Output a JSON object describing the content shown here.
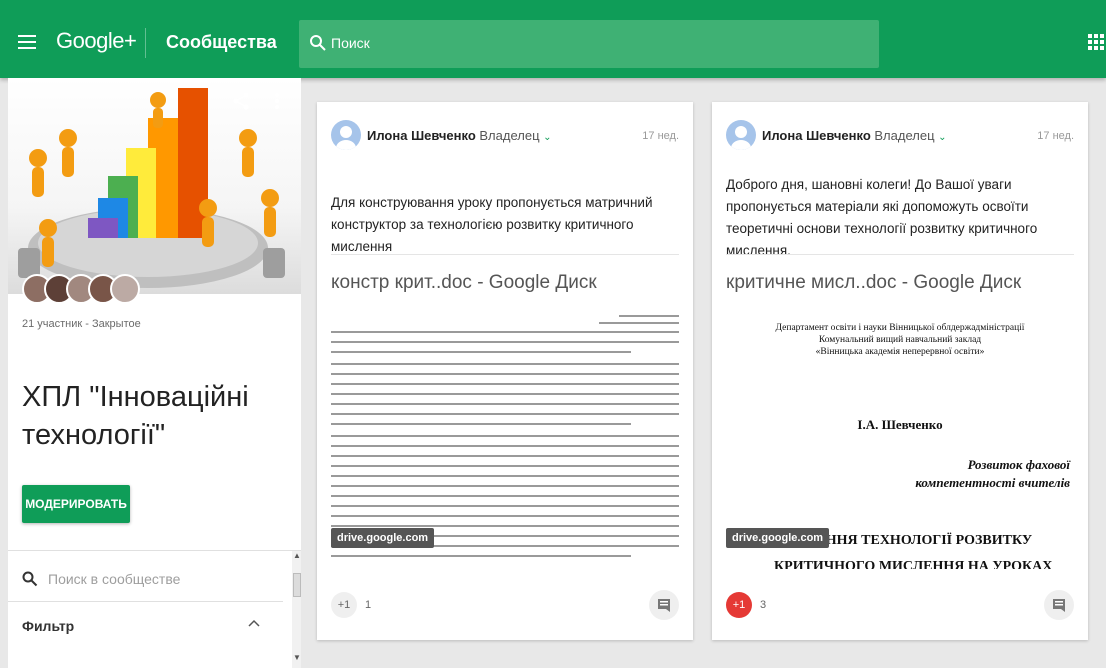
{
  "header": {
    "brand": "Google+",
    "section": "Сообщества",
    "search_placeholder": "Поиск"
  },
  "community": {
    "members": "21 участник - Закрытое",
    "title": "ХПЛ \"Інноваційні технології\"",
    "moderate_label": "МОДЕРИРОВАТЬ",
    "search_placeholder": "Поиск в сообществе",
    "filter_label": "Фильтр"
  },
  "posts": [
    {
      "author": "Илона Шевченко",
      "role": "Владелец",
      "time": "17 нед.",
      "text": "Для конструювання уроку пропонується матричний конструктор за технологією розвитку критичного мислення",
      "link_title": "констр крит..doc - Google Диск",
      "domain": "drive.google.com",
      "plus_label": "+1",
      "plus_count": "1"
    },
    {
      "author": "Илона Шевченко",
      "role": "Владелец",
      "time": "17 нед.",
      "text": "Доброго дня, шановні колеги! До Вашої уваги пропонується матеріали які допоможуть освоїти теоретичні основи технології розвитку критичного мислення.",
      "link_title": "критичне мисл..doc - Google Диск",
      "domain": "drive.google.com",
      "plus_label": "+1",
      "plus_count": "3",
      "preview": {
        "line1": "Департамент освіти і науки Вінницької облдержадміністрації",
        "line2": "Комунальний вищий навчальний заклад",
        "line3": "«Вінницька академія неперервної освіти»",
        "author_name": "І.А. Шевченко",
        "subtitle1": "Розвиток фахової",
        "subtitle2": "компетентності вчителів",
        "heading1": "…ИСТАННЯ ТЕХНОЛОГІЇ РОЗВИТКУ",
        "heading2": "КРИТИЧНОГО МИСЛЕННЯ НА УРОКАХ"
      }
    }
  ],
  "colors": {
    "brand_green": "#0f9d58",
    "plus_red": "#e53935"
  }
}
